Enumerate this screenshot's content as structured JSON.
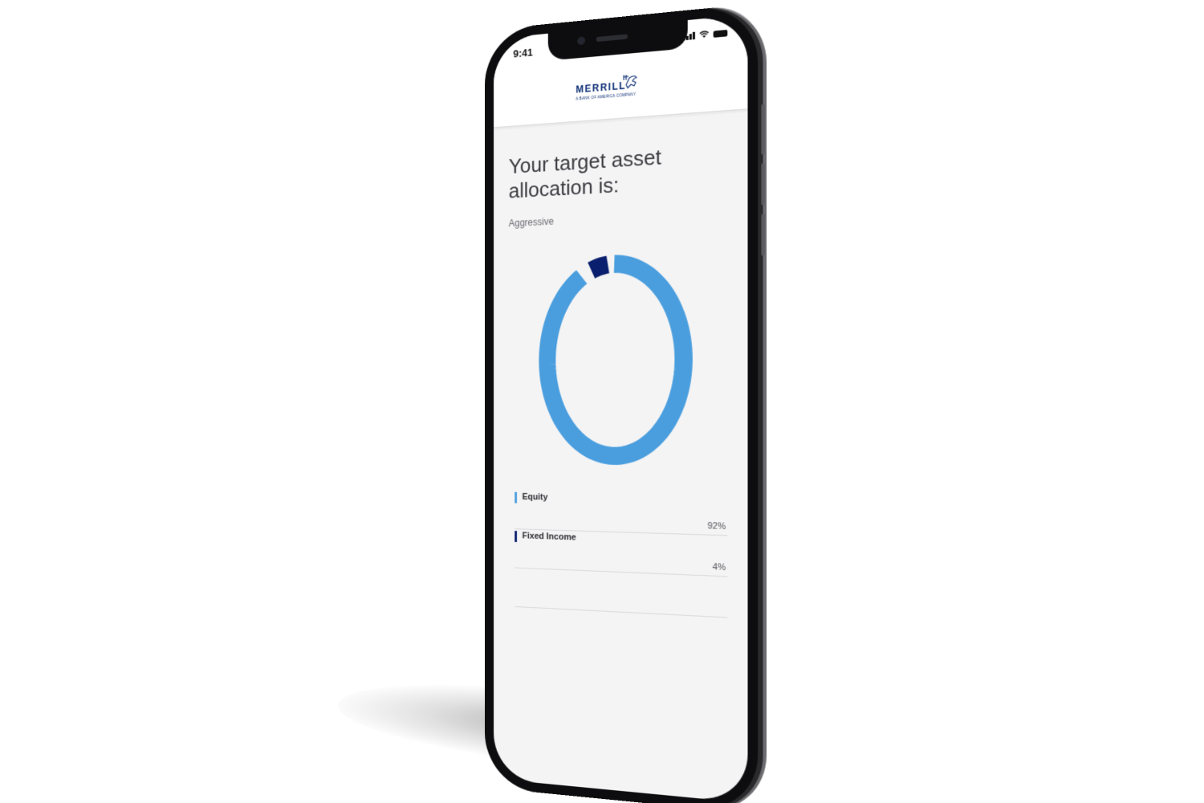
{
  "status_bar": {
    "time": "9:41"
  },
  "header": {
    "logo_text": "MERRILL",
    "logo_subtext": "A BANK OF AMERICA COMPANY",
    "logo_icon": "bull-icon"
  },
  "page": {
    "title": "Your target asset allocation is:",
    "risk_level": "Aggressive"
  },
  "allocation": {
    "items": [
      {
        "label": "Equity",
        "value": "92%",
        "color": "#4a9ede"
      },
      {
        "label": "Fixed Income",
        "value": "4%",
        "color": "#0a1f6e"
      }
    ]
  },
  "chart_data": {
    "type": "pie",
    "categories": [
      "Equity",
      "Fixed Income"
    ],
    "values": [
      92,
      4
    ],
    "colors": [
      "#4a9ede",
      "#0a1f6e"
    ]
  }
}
